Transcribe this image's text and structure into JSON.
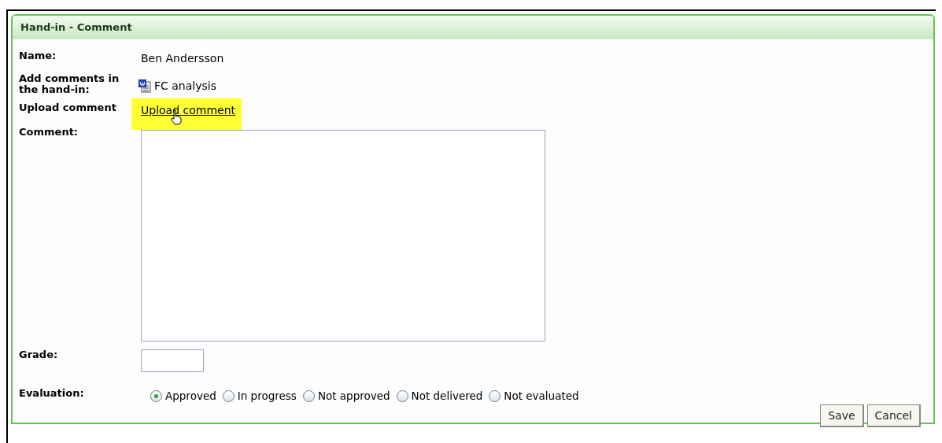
{
  "panel": {
    "title": "Hand-in - Comment"
  },
  "fields": [
    {
      "kind": "text",
      "label": "Name:",
      "value": "Ben Andersson"
    },
    {
      "kind": "file",
      "label": "Add comments in the hand-in:",
      "value": "FC analysis"
    },
    {
      "kind": "link",
      "label": "Upload comment",
      "value": "Upload comment",
      "highlighted": true
    },
    {
      "kind": "textarea",
      "label": "Comment:"
    },
    {
      "kind": "input",
      "label": "Grade:"
    },
    {
      "kind": "radios",
      "label": "Evaluation:",
      "options": [
        {
          "label": "Approved",
          "selected": true
        },
        {
          "label": "In progress",
          "selected": false
        },
        {
          "label": "Not approved",
          "selected": false
        },
        {
          "label": "Not delivered",
          "selected": false
        },
        {
          "label": "Not evaluated",
          "selected": false
        }
      ]
    }
  ],
  "buttons": [
    "Save",
    "Cancel"
  ]
}
